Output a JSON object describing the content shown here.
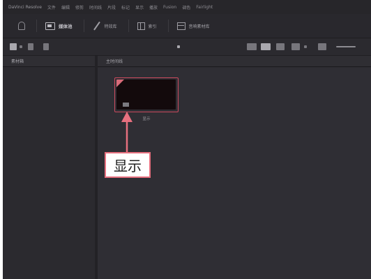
{
  "colors": {
    "app_bg": "#2a292e",
    "accent_highlight": "#e7707f",
    "clip_border": "#cc4a5e",
    "clip_bg": "#130a0c"
  },
  "menu": {
    "items": [
      "DaVinci Resolve",
      "文件",
      "编辑",
      "修剪",
      "时间线",
      "片段",
      "标记",
      "显示",
      "播放",
      "Fusion",
      "调色",
      "Fairlight"
    ]
  },
  "toolbar": {
    "items": [
      {
        "icon": "key-icon",
        "label": ""
      },
      {
        "icon": "media-pool-icon",
        "label": "媒体池"
      },
      {
        "icon": "effects-icon",
        "label": "特效库"
      },
      {
        "icon": "edit-index-icon",
        "label": "索引"
      },
      {
        "icon": "sound-library-icon",
        "label": "音响素材库"
      }
    ]
  },
  "panels": {
    "left_header": "素材箱",
    "right_header": "主时间线"
  },
  "clip": {
    "name": "显示"
  },
  "callout": {
    "text": "显示"
  }
}
